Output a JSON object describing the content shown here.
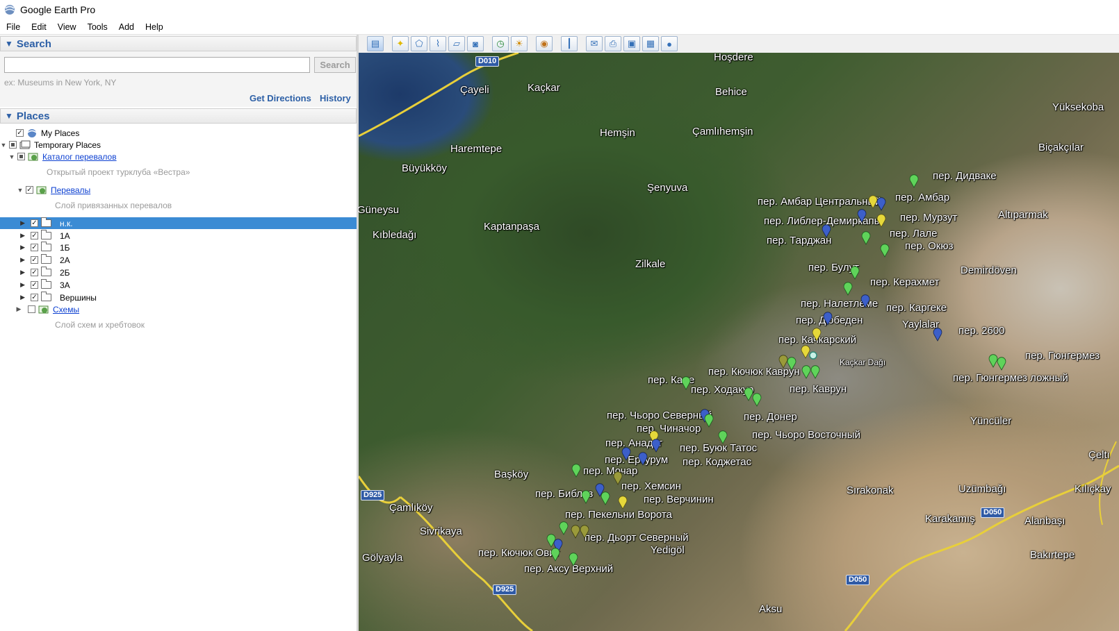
{
  "window": {
    "title": "Google Earth Pro"
  },
  "menu": [
    "File",
    "Edit",
    "View",
    "Tools",
    "Add",
    "Help"
  ],
  "search": {
    "header": "Search",
    "input_value": "",
    "button_label": "Search",
    "hint": "ex: Museums in New York, NY",
    "get_directions": "Get Directions",
    "history": "History"
  },
  "places": {
    "header": "Places",
    "my_places": "My Places",
    "temporary_places": "Temporary Places",
    "catalog": {
      "label": "Каталог перевалов",
      "description": "Открытый проект турклуба «Вестра»"
    },
    "passes": {
      "label": "Перевалы",
      "description": "Слой привязанных перевалов"
    },
    "folders": [
      "н.к.",
      "1А",
      "1Б",
      "2А",
      "2Б",
      "3А",
      "Вершины"
    ],
    "selected_folder": "н.к.",
    "schemes": {
      "label": "Схемы",
      "description": "Слой схем и хребтовок"
    }
  },
  "toolbar": {
    "buttons": [
      "sidebar-toggle",
      "placemark",
      "polygon",
      "path",
      "image-overlay",
      "record-tour",
      "historical-imagery",
      "sunlight",
      "planets",
      "ruler",
      "email",
      "print",
      "save-image",
      "view-in-maps",
      "earth"
    ]
  },
  "map": {
    "places": [
      {
        "name": "Hoşdere"
      },
      {
        "name": "Çayeli"
      },
      {
        "name": "Kaçkar"
      },
      {
        "name": "Behice"
      },
      {
        "name": "Hemşin"
      },
      {
        "name": "Çamlıhemşin"
      },
      {
        "name": "Haremtepe"
      },
      {
        "name": "Büyükköy"
      },
      {
        "name": "Şenyuva"
      },
      {
        "name": "Güneysu"
      },
      {
        "name": "Kıbledağı"
      },
      {
        "name": "Kaptanpaşa"
      },
      {
        "name": "Zilkale"
      },
      {
        "name": "Yüksekoba"
      },
      {
        "name": "Biçakçılar"
      },
      {
        "name": "Altıparmak"
      },
      {
        "name": "Demirdöven"
      },
      {
        "name": "Yaylalar"
      },
      {
        "name": "Kaçkar Dağı"
      },
      {
        "name": "Yüncüler"
      },
      {
        "name": "Başköy"
      },
      {
        "name": "Sırakonak"
      },
      {
        "name": "Uzümbağı"
      },
      {
        "name": "Kılıçkay"
      },
      {
        "name": "Çamlıköy"
      },
      {
        "name": "Sivrikaya"
      },
      {
        "name": "Gölyayla"
      },
      {
        "name": "Yedigöl"
      },
      {
        "name": "Karakamış"
      },
      {
        "name": "Alanbaşı"
      },
      {
        "name": "Bakırtepe"
      },
      {
        "name": "Aksu"
      },
      {
        "name": "Çeltı"
      }
    ],
    "roads": [
      "D010",
      "D925",
      "D925",
      "D050",
      "D050"
    ],
    "passes": [
      "пер. Дидваке",
      "пер. Амбар Центральный",
      "пер. Амбар",
      "пер. Либлер-Демиркапы",
      "пер. Мурзут",
      "пер. Тарджан",
      "пер. Лале",
      "пер. Окюз",
      "пер. Булут",
      "пер. Керахмет",
      "пер. Налетлеме",
      "пер. Каргеке",
      "пер. Дюбеден",
      "пер. 2600",
      "пер. Качкарский",
      "пер. Гюнгермез",
      "пер. Кючюк Каврун",
      "пер. Гюнгермез ложный",
      "пер. Кале",
      "пер. Ходакур",
      "пер. Каврун",
      "пер. Чьоро Северный",
      "пер. Донер",
      "пер. Чиначор",
      "пер. Чьоро Восточный",
      "пер. Анадаг",
      "пер. Буюк Татос",
      "пер. Ерзурум",
      "пер. Коджетас",
      "пер. Мочар",
      "пер. Хемсин",
      "пер. Библоз",
      "пер. Верчинин",
      "пер. Пекельни Ворота",
      "пер. Дьорт Северный",
      "пер. Кючюк Овит",
      "пер. Аксу Верхний"
    ],
    "pin_colors": {
      "green": "#5fd35a",
      "blue": "#3c5fc9",
      "yellow": "#e6d83a",
      "olive": "#9a9a3a"
    }
  }
}
